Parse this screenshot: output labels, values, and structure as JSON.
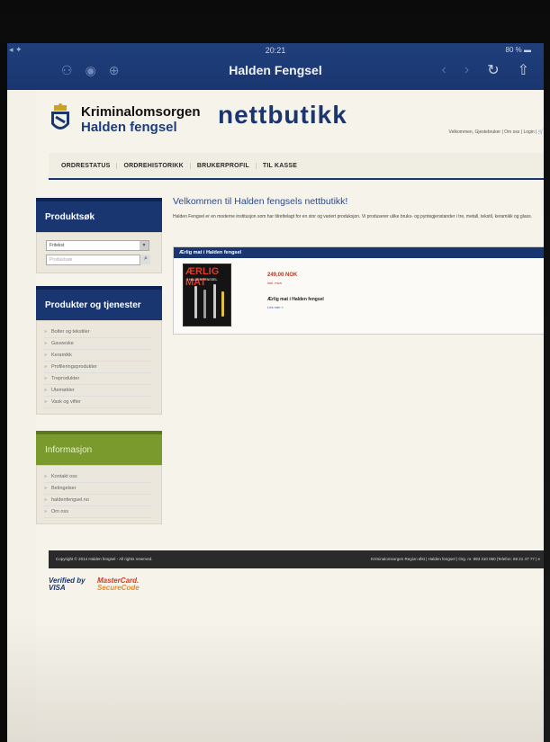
{
  "ios": {
    "time": "20:21",
    "battery": "80 %",
    "title": "Halden Fengsel"
  },
  "site": {
    "logo_line1": "Kriminalomsorgen",
    "logo_line2": "Halden fengsel",
    "shop_title": "nettbutikk",
    "header_links": "Velkommen, Gjestebruker | Om oss | Login | ",
    "nav": [
      "ORDRESTATUS",
      "ORDREHISTORIKK",
      "BRUKERPROFIL",
      "TIL KASSE"
    ]
  },
  "sidebar": {
    "search_title": "Produktsøk",
    "search_select": "Fritekst",
    "search_placeholder": "Produktsøk",
    "products_title": "Produkter og tjenester",
    "categories": [
      "Bolter og tekstiler",
      "Gaveeske",
      "Keramikk",
      "Profileringsprodukter",
      "Treprodukter",
      "Utemøbler",
      "Vask og vifter"
    ],
    "info_title": "Informasjon",
    "info_links": [
      "Kontakt oss",
      "Betingelser",
      "haldenfengsel.no",
      "Om oss"
    ]
  },
  "content": {
    "welcome": "Velkommen til Halden fengsels nettbutikk!",
    "intro": "Halden Fengsel er en moderne institusjon som har tilrettelagt for en stor og variert produksjon. Vi produserer ulike bruks- og pyntegjenstander i tre, metall, tekstil, keramikk og glass.",
    "product": {
      "box_header": "Ærlig mat i Halden fengsel",
      "cover_title": "ÆRLIG MAT",
      "cover_subtitle": "I HALDEN FENGSEL",
      "price": "249,00 NOK",
      "vat": "inkl. mva",
      "name": "Ærlig mat i Halden fengsel",
      "read_more": "Les mer »"
    }
  },
  "footer": {
    "left": "Copyright © 2014 Halden fengsel - All rights reserved.",
    "right": "Kriminalomsorgen Region Øst | Halden fengsel | Org. nr. 993 310 050 |Telefon: 69 21 47 77 | e"
  },
  "payments": {
    "visa_top": "Verified by",
    "visa_bottom": "VISA",
    "mc_top": "MasterCard.",
    "mc_bottom": "SecureCode"
  },
  "colors": {
    "brand_blue": "#1a3670",
    "info_green": "#7a9a2e",
    "price_red": "#c03020"
  }
}
